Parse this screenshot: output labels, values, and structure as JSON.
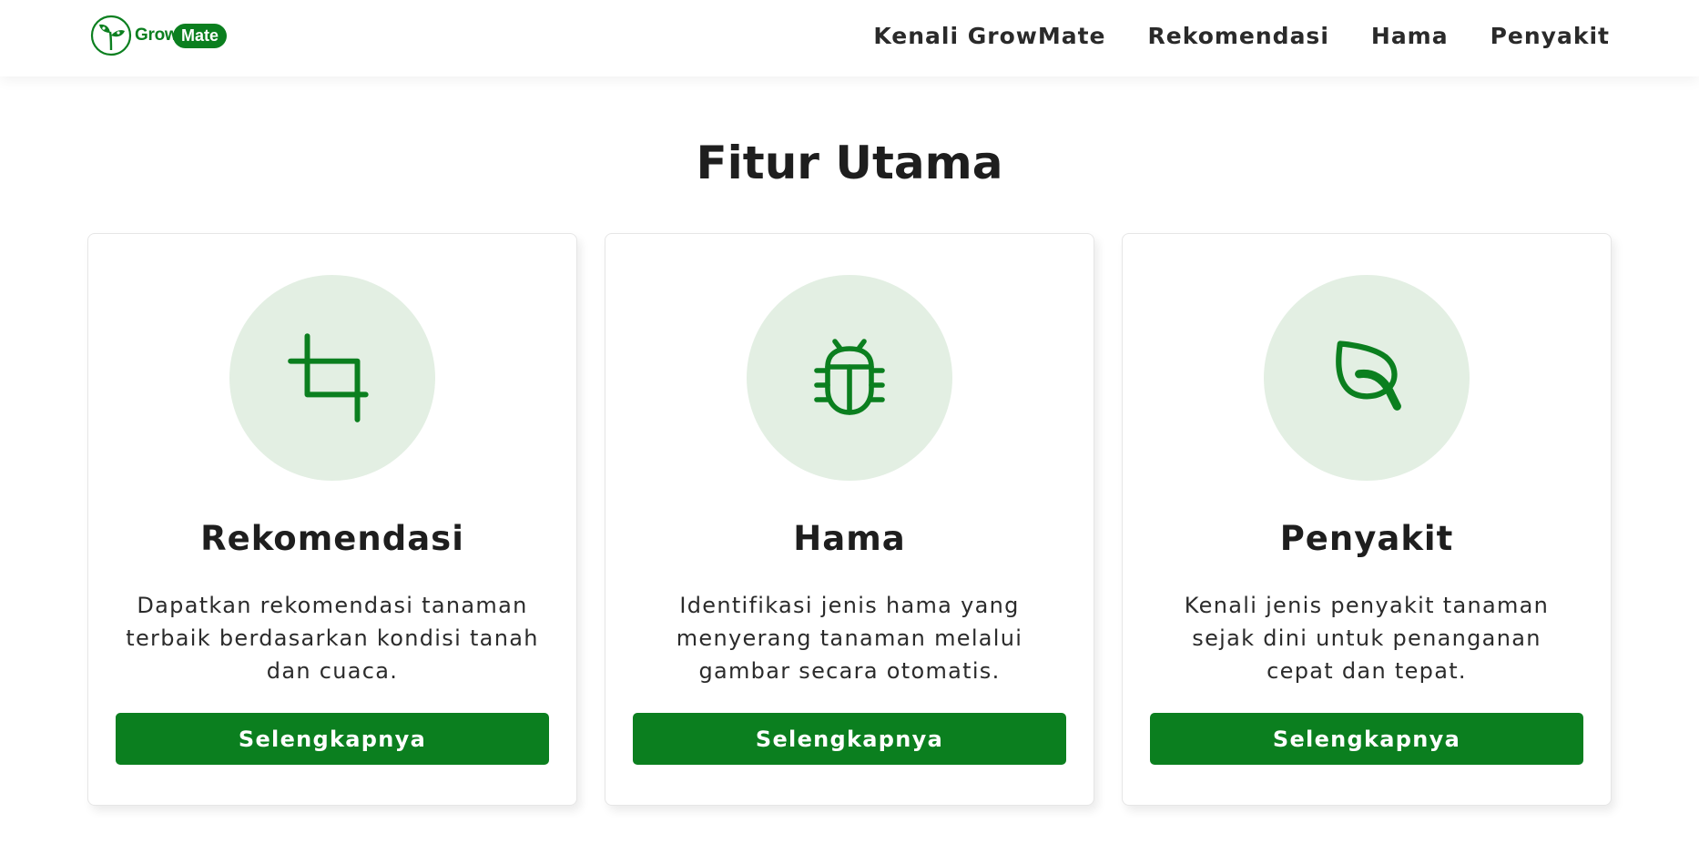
{
  "brand": {
    "name_part1": "Grow",
    "name_part2": "Mate",
    "accent_color": "#0b7f1f",
    "icon": "seedling-icon"
  },
  "nav": {
    "items": [
      {
        "label": "Kenali GrowMate"
      },
      {
        "label": "Rekomendasi"
      },
      {
        "label": "Hama"
      },
      {
        "label": "Penyakit"
      }
    ]
  },
  "section": {
    "title": "Fitur Utama"
  },
  "cards": [
    {
      "icon": "crop-icon",
      "title": "Rekomendasi",
      "description": "Dapatkan rekomendasi tanaman terbaik berdasarkan kondisi tanah dan cuaca.",
      "button": "Selengkapnya"
    },
    {
      "icon": "bug-icon",
      "title": "Hama",
      "description": "Identifikasi jenis hama yang menyerang tanaman melalui gambar secara otomatis.",
      "button": "Selengkapnya"
    },
    {
      "icon": "leaf-icon",
      "title": "Penyakit",
      "description": "Kenali jenis penyakit tanaman sejak dini untuk penanganan cepat dan tepat.",
      "button": "Selengkapnya"
    }
  ]
}
